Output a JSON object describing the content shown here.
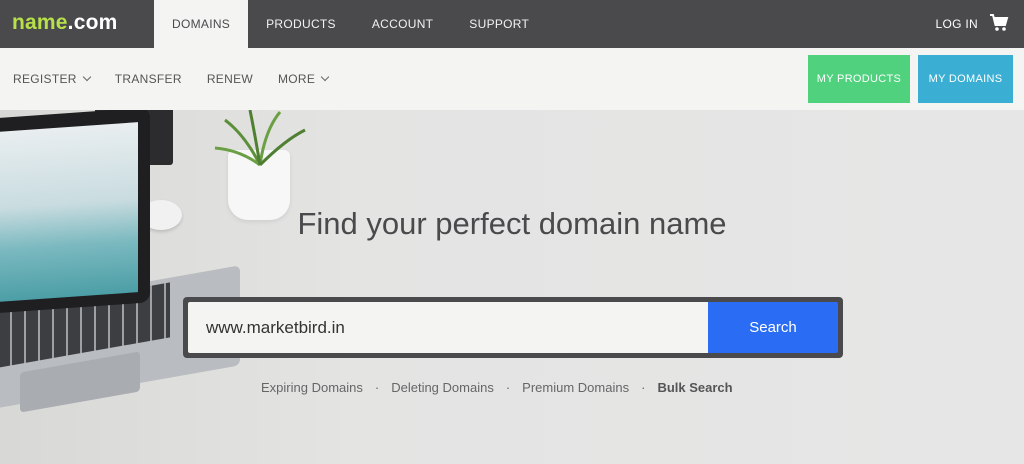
{
  "logo": {
    "name": "name",
    "com": ".com"
  },
  "topnav": {
    "items": [
      {
        "label": "DOMAINS"
      },
      {
        "label": "PRODUCTS"
      },
      {
        "label": "ACCOUNT"
      },
      {
        "label": "SUPPORT"
      }
    ],
    "login": "LOG IN",
    "cart_icon": "cart-icon"
  },
  "subnav": {
    "items": [
      {
        "label": "REGISTER"
      },
      {
        "label": "TRANSFER"
      },
      {
        "label": "RENEW"
      },
      {
        "label": "MORE"
      }
    ],
    "my_products": "MY PRODUCTS",
    "my_domains": "MY DOMAINS"
  },
  "hero": {
    "headline": "Find your perfect domain name",
    "search_value": "www.marketbird.in",
    "search_button": "Search",
    "links": [
      "Expiring Domains",
      "Deleting Domains",
      "Premium Domains",
      "Bulk Search"
    ]
  },
  "colors": {
    "topbar": "#4a4a4d",
    "logo_green": "#b7e04a",
    "my_products": "#4fd17e",
    "my_domains": "#3aaed3",
    "search_button": "#2a6df4"
  }
}
